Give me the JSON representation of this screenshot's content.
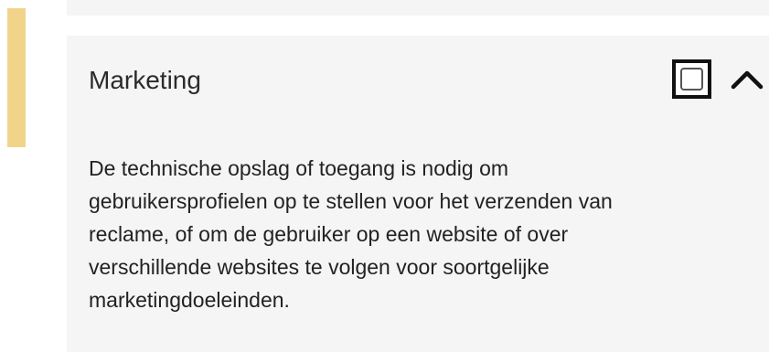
{
  "category": {
    "title": "Marketing",
    "checked": false,
    "expanded": true,
    "description_lines": [
      "De technische opslag of toegang is nodig om",
      "gebruikersprofielen op te stellen voor het verzenden van",
      "reclame, of om de gebruiker op een website of over",
      "verschillende websites te volgen voor soortgelijke",
      "marketingdoeleinden."
    ]
  },
  "icons": {
    "toggle": "chevron-up-icon",
    "checkbox": "checkbox-icon"
  },
  "colors": {
    "accent": "#f1d48a",
    "panel_background": "#f5f5f5",
    "text": "#222222"
  }
}
